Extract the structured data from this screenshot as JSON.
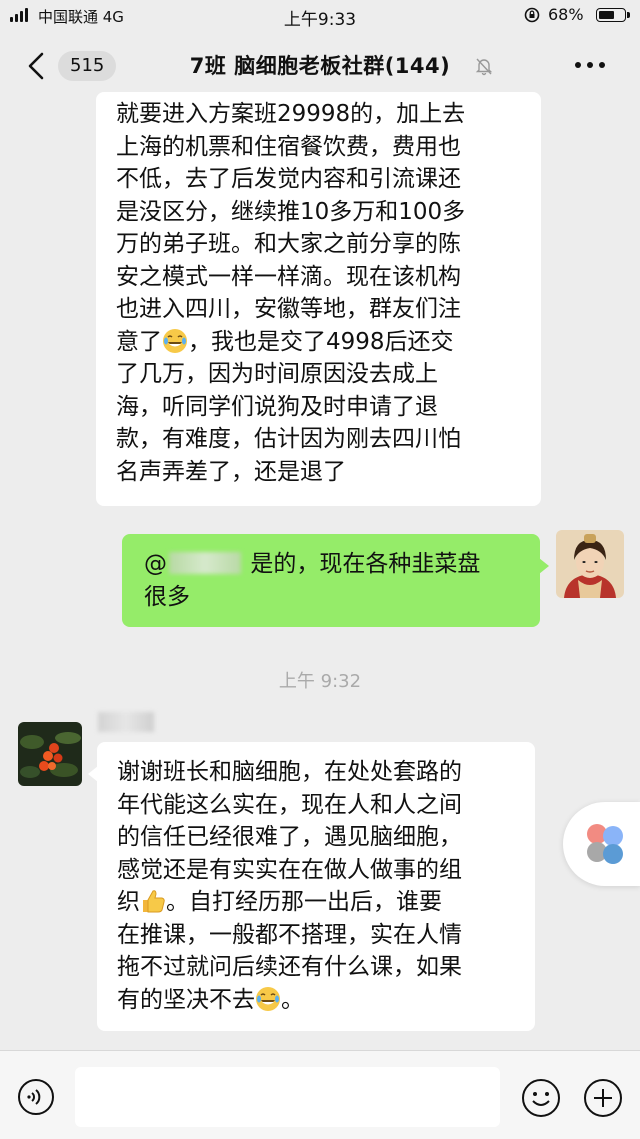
{
  "status_bar": {
    "carrier": "中国联通 4G",
    "time": "上午9:33",
    "battery": "68%",
    "battery_level": 0.68
  },
  "nav": {
    "unread_badge": "515",
    "title": "7班 脑细胞老板社群(144)"
  },
  "messages": [
    {
      "side": "left",
      "lines": [
        "就要进入方案班29998的，加上去",
        "上海的机票和住宿餐饮费，费用也",
        "不低，去了后发觉内容和引流课还",
        "是没区分，继续推10多万和100多",
        "万的弟子班。和大家之前分享的陈",
        "安之模式一样一样滴。现在该机构",
        "也进入四川，安徽等地，群友们注",
        "意了",
        "，我也是交了4998后还交",
        "了几万，因为时间原因没去成上",
        "海，听同学们说狗及时申请了退",
        "款，有难度，估计因为刚去四川怕",
        "名声弄差了，还是退了"
      ]
    },
    {
      "side": "right",
      "mention_prefix": "@",
      "line1": "是的，现在各种韭菜盘",
      "line2": "很多"
    },
    {
      "side": "left",
      "lines": [
        "谢谢班长和脑细胞，在处处套路的",
        "年代能这么实在，现在人和人之间",
        "的信任已经很难了，遇见脑细胞，",
        "感觉还是有实实在在做人做事的组",
        "织",
        "。自打经历那一出后，谁要",
        "在推课，一般都不搭理，实在人情",
        "拖不过就问后续还有什么课，如果",
        "有的坚决不去",
        "。"
      ]
    }
  ],
  "timestamp": "上午 9:32",
  "icons": {
    "laugh": "face-with-tears-of-joy-icon",
    "thumbs": "thumbs-up-icon",
    "voice": "voice-input-icon",
    "emoji": "emoji-icon",
    "plus": "plus-icon"
  },
  "colors": {
    "background": "#ededed",
    "self_bubble": "#95ec69",
    "other_bubble": "#ffffff",
    "timestamp_text": "#aaaaaa"
  }
}
